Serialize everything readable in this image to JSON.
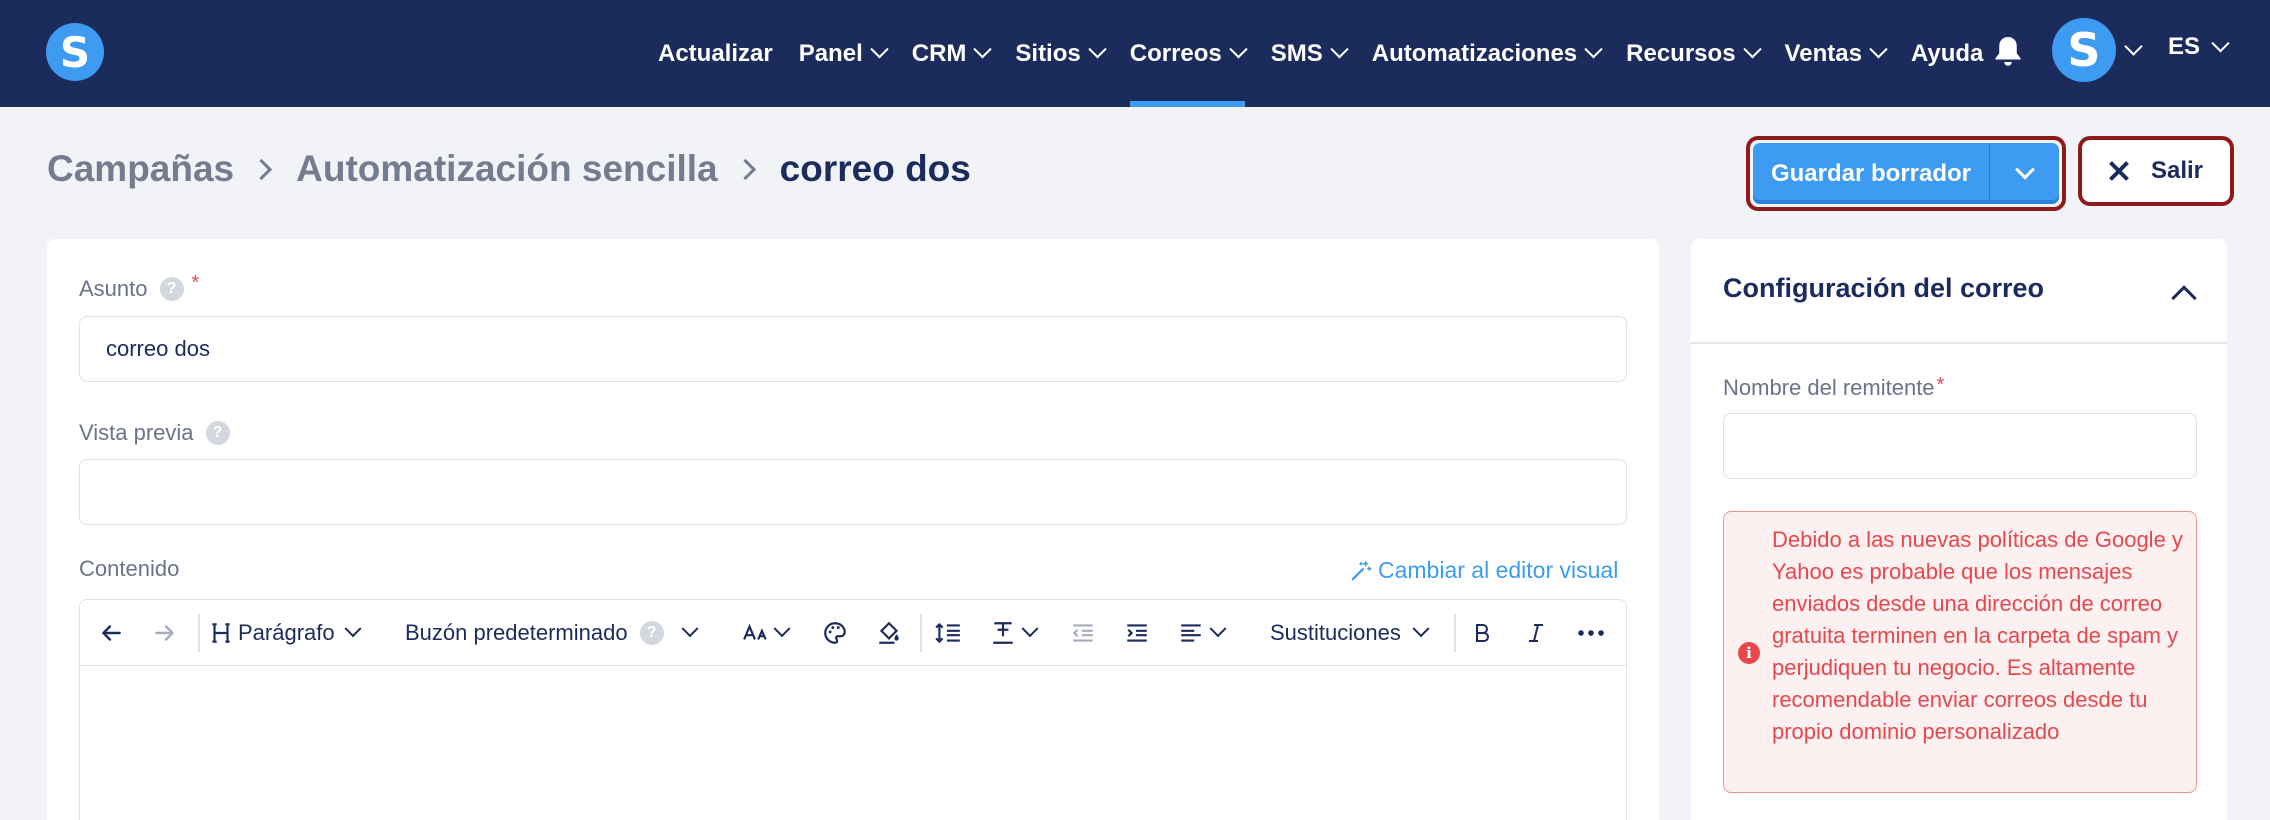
{
  "logo": "S",
  "nav": {
    "items": [
      {
        "label": "Actualizar",
        "dropdown": false,
        "active": false
      },
      {
        "label": "Panel",
        "dropdown": true,
        "active": false
      },
      {
        "label": "CRM",
        "dropdown": true,
        "active": false
      },
      {
        "label": "Sitios",
        "dropdown": true,
        "active": false
      },
      {
        "label": "Correos",
        "dropdown": true,
        "active": true
      },
      {
        "label": "SMS",
        "dropdown": true,
        "active": false
      },
      {
        "label": "Automatizaciones",
        "dropdown": true,
        "active": false
      },
      {
        "label": "Recursos",
        "dropdown": true,
        "active": false
      },
      {
        "label": "Ventas",
        "dropdown": true,
        "active": false
      },
      {
        "label": "Ayuda",
        "dropdown": false,
        "active": false
      }
    ],
    "avatar_initial": "S",
    "language": "ES"
  },
  "breadcrumb": {
    "items": [
      "Campañas",
      "Automatización sencilla"
    ],
    "current": "correo dos"
  },
  "actions": {
    "save_label": "Guardar borrador",
    "exit_label": "Salir"
  },
  "form": {
    "subject_label": "Asunto",
    "subject_required": "*",
    "subject_value": "correo dos",
    "preview_label": "Vista previa",
    "preview_value": "",
    "content_label": "Contenido",
    "switch_editor_label": "Cambiar al editor visual",
    "help_glyph": "?"
  },
  "toolbar": {
    "paragraph_label": "Parágrafo",
    "mailbox_label": "Buzón predeterminado",
    "substitutions_label": "Sustituciones"
  },
  "sidebar": {
    "title": "Configuración del correo",
    "sender_label": "Nombre del remitente",
    "sender_required": "*",
    "sender_value": "",
    "alert_icon": "i",
    "alert_text": "Debido a las nuevas políticas de Google y Yahoo es probable que los mensajes enviados desde una dirección de correo gratuita terminen en la carpeta de spam y perjudiquen tu negocio. Es altamente recomendable enviar correos desde tu propio dominio personalizado"
  },
  "colors": {
    "navbar": "#1b2b5c",
    "accent": "#3d9bf2",
    "alert": "#e5484d",
    "highlight_border": "#8e1b1b"
  }
}
